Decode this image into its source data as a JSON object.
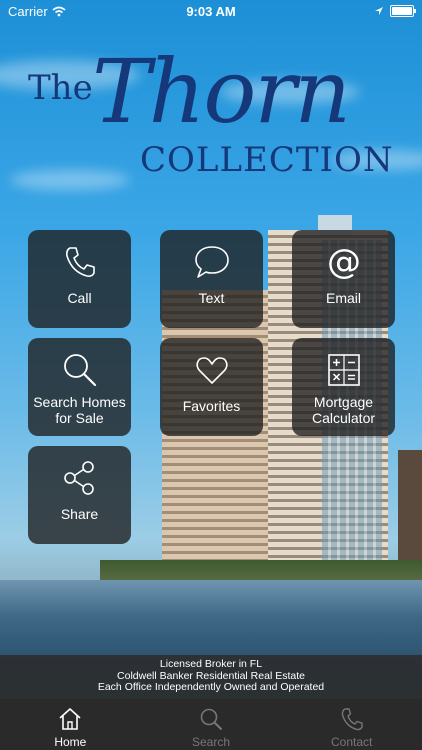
{
  "status_bar": {
    "carrier": "Carrier",
    "time": "9:03 AM"
  },
  "logo": {
    "the": "The",
    "thorn": "Thorn",
    "collection": "COLLECTION"
  },
  "tiles": {
    "call": "Call",
    "text": "Text",
    "email": "Email",
    "search_line1": "Search Homes",
    "search_line2": "for Sale",
    "favorites": "Favorites",
    "mortgage_line1": "Mortgage",
    "mortgage_line2": "Calculator",
    "share": "Share"
  },
  "license": {
    "line1": "Licensed Broker in FL",
    "line2": "Coldwell Banker Residential Real Estate",
    "line3": "Each Office Independently Owned and Operated"
  },
  "tabbar": {
    "tabs": [
      {
        "label": "Home",
        "icon": "house-icon",
        "active": true
      },
      {
        "label": "Search",
        "icon": "search-icon",
        "active": false
      },
      {
        "label": "Contact",
        "icon": "phone-icon",
        "active": false
      }
    ]
  },
  "colors": {
    "logo": "#15387a",
    "tile_bg": "#1e1e1e",
    "tabbar_bg": "#2a2a2a"
  }
}
